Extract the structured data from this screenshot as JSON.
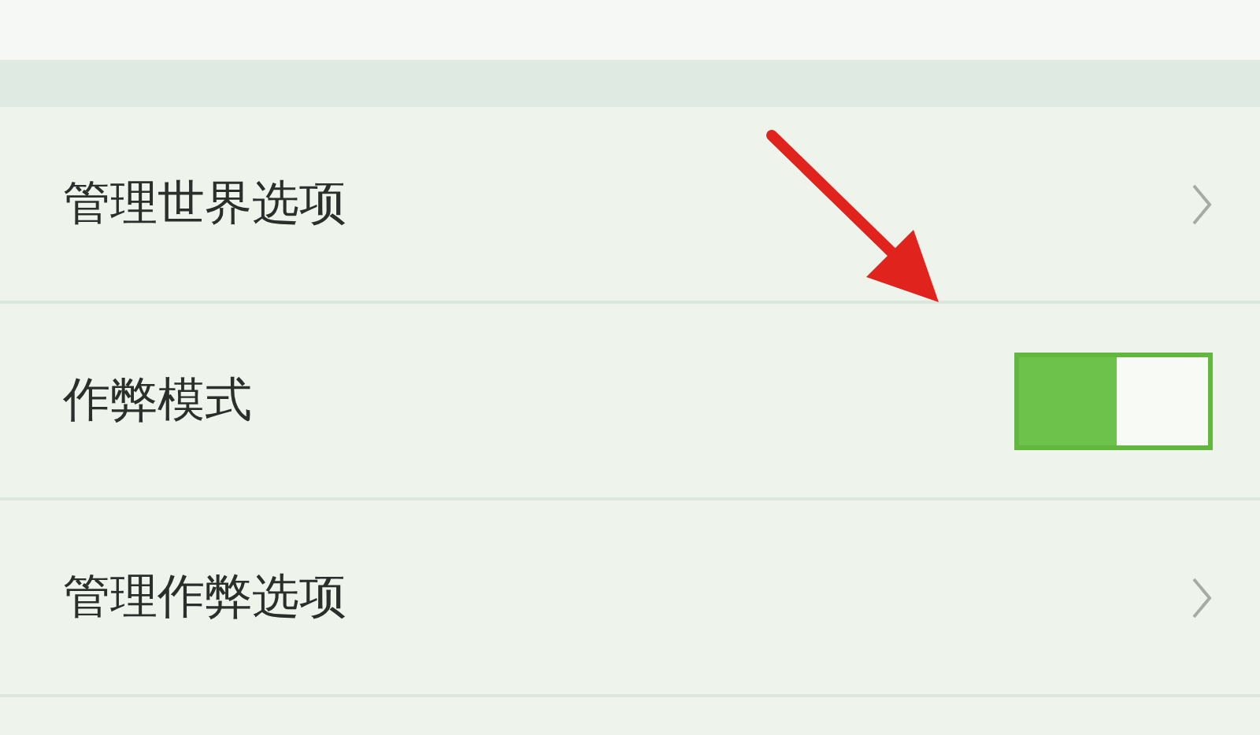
{
  "rows": [
    {
      "kind": "link",
      "label": "管理世界选项"
    },
    {
      "kind": "toggle",
      "label": "作弊模式",
      "on": true
    },
    {
      "kind": "link",
      "label": "管理作弊选项"
    }
  ]
}
